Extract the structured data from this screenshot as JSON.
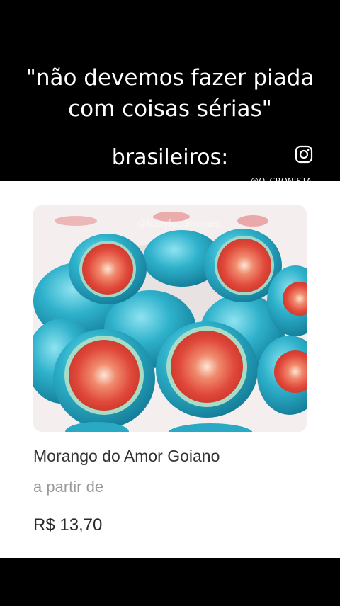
{
  "meme": {
    "quote_line1": "\"não devemos fazer piada",
    "quote_line2": "com coisas sérias\"",
    "answer": "brasileiros:",
    "handle": "@O_CRONISTA",
    "instagram_icon": "instagram-icon"
  },
  "product": {
    "photo_watermark": "@babyfoodmemes",
    "photo_alt": "blue-covered strawberries",
    "name": "Morango do Amor Goiano",
    "price_prefix": "a partir de",
    "price": "R$ 13,70"
  },
  "colors": {
    "background": "#000000",
    "card": "#ffffff",
    "candy_blue": "#2aa9c4",
    "strawberry_red": "#e2503f"
  }
}
